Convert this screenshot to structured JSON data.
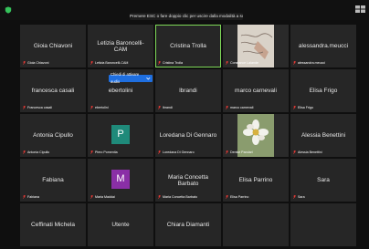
{
  "top_notice": "Premere ESC o fare doppio clic per uscire dalla modalità a schermo intero",
  "tooltip": {
    "text": "Chiedi di attivare audio",
    "chevron": "chevron-down-icon"
  },
  "colors": {
    "active_border": "#7ed957",
    "tile_bg": "#262626",
    "avatar_p": "#1f8a7a",
    "avatar_m": "#8a2fa6",
    "tooltip_bg": "#1f6fe0",
    "mic_muted": "#e53935"
  },
  "participants": [
    {
      "name": "Gioia Chiavoni",
      "label": "Gioia Chiavoni"
    },
    {
      "name": "Letizia Baroncelli-CAM",
      "label": "Letizia Baroncelli-CAM"
    },
    {
      "name": "Cristina Trolla",
      "label": "Cristina Trolla",
      "active": true
    },
    {
      "name": "",
      "label": "Constance Lalande",
      "video": "photo-handwriting"
    },
    {
      "name": "alessandra.meucci",
      "label": "alessandra.meucci"
    },
    {
      "name": "francesca casali",
      "label": "Francesca casali"
    },
    {
      "name": "ebertolini",
      "label": "ebertolini"
    },
    {
      "name": "lbrandi",
      "label": "lbrandi"
    },
    {
      "name": "marco carnevali",
      "label": "marco carnevali"
    },
    {
      "name": "Elisa Frigo",
      "label": "Elisa Frigo"
    },
    {
      "name": "Antonia Cipullo",
      "label": "Antonia Cipullo"
    },
    {
      "name": "",
      "label": "Piero Pomentia",
      "avatar": "P"
    },
    {
      "name": "Loredana Di Gennaro",
      "label": "Loredana Di Gennaro"
    },
    {
      "name": "",
      "label": "Denise Parolari",
      "video": "photo-flower"
    },
    {
      "name": "Alessia Benettini",
      "label": "Alessia Benettini"
    },
    {
      "name": "Fabiana",
      "label": "Fabiana"
    },
    {
      "name": "",
      "label": "Maria Maddai",
      "avatar": "M"
    },
    {
      "name": "Maria Concetta Barbato",
      "label": "Maria Concetta Barbato"
    },
    {
      "name": "Elisa Parrino",
      "label": "Elisa Parrino"
    },
    {
      "name": "Sara",
      "label": "Sara"
    },
    {
      "name": "Ceffinati Michela",
      "label": ""
    },
    {
      "name": "Utente",
      "label": ""
    },
    {
      "name": "Chiara Diamanti",
      "label": ""
    },
    {
      "name": "",
      "label": ""
    },
    {
      "name": "",
      "label": ""
    }
  ]
}
